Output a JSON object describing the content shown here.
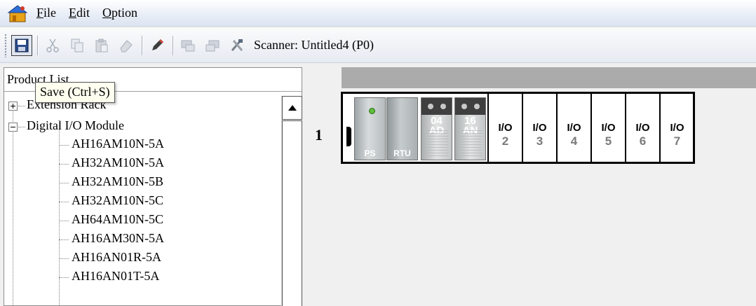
{
  "menu": {
    "items": [
      {
        "accel": "F",
        "rest": "ile"
      },
      {
        "accel": "E",
        "rest": "dit"
      },
      {
        "accel": "O",
        "rest": "ption"
      }
    ]
  },
  "toolbar": {
    "scanner_label": "Scanner: Untitled4 (P0)"
  },
  "tooltip": {
    "text": "Save (Ctrl+S)"
  },
  "left_panel": {
    "title": "Product List",
    "tree": {
      "extension_rack": "Extension Rack",
      "digital_io_module": "Digital I/O Module",
      "items": [
        "AH16AM10N-5A",
        "AH32AM10N-5A",
        "AH32AM10N-5B",
        "AH32AM10N-5C",
        "AH64AM10N-5C",
        "AH16AM30N-5A",
        "AH16AN01R-5A",
        "AH16AN01T-5A"
      ]
    }
  },
  "rack": {
    "number": "1",
    "modules": {
      "ps": "PS",
      "rtu": "RTU",
      "ad": {
        "line1": "04",
        "line2": "AD"
      },
      "an": {
        "line1": "16",
        "line2": "AN"
      }
    },
    "io_slots": [
      {
        "label": "I/O",
        "num": "2"
      },
      {
        "label": "I/O",
        "num": "3"
      },
      {
        "label": "I/O",
        "num": "4"
      },
      {
        "label": "I/O",
        "num": "5"
      },
      {
        "label": "I/O",
        "num": "6"
      },
      {
        "label": "I/O",
        "num": "7"
      }
    ]
  }
}
